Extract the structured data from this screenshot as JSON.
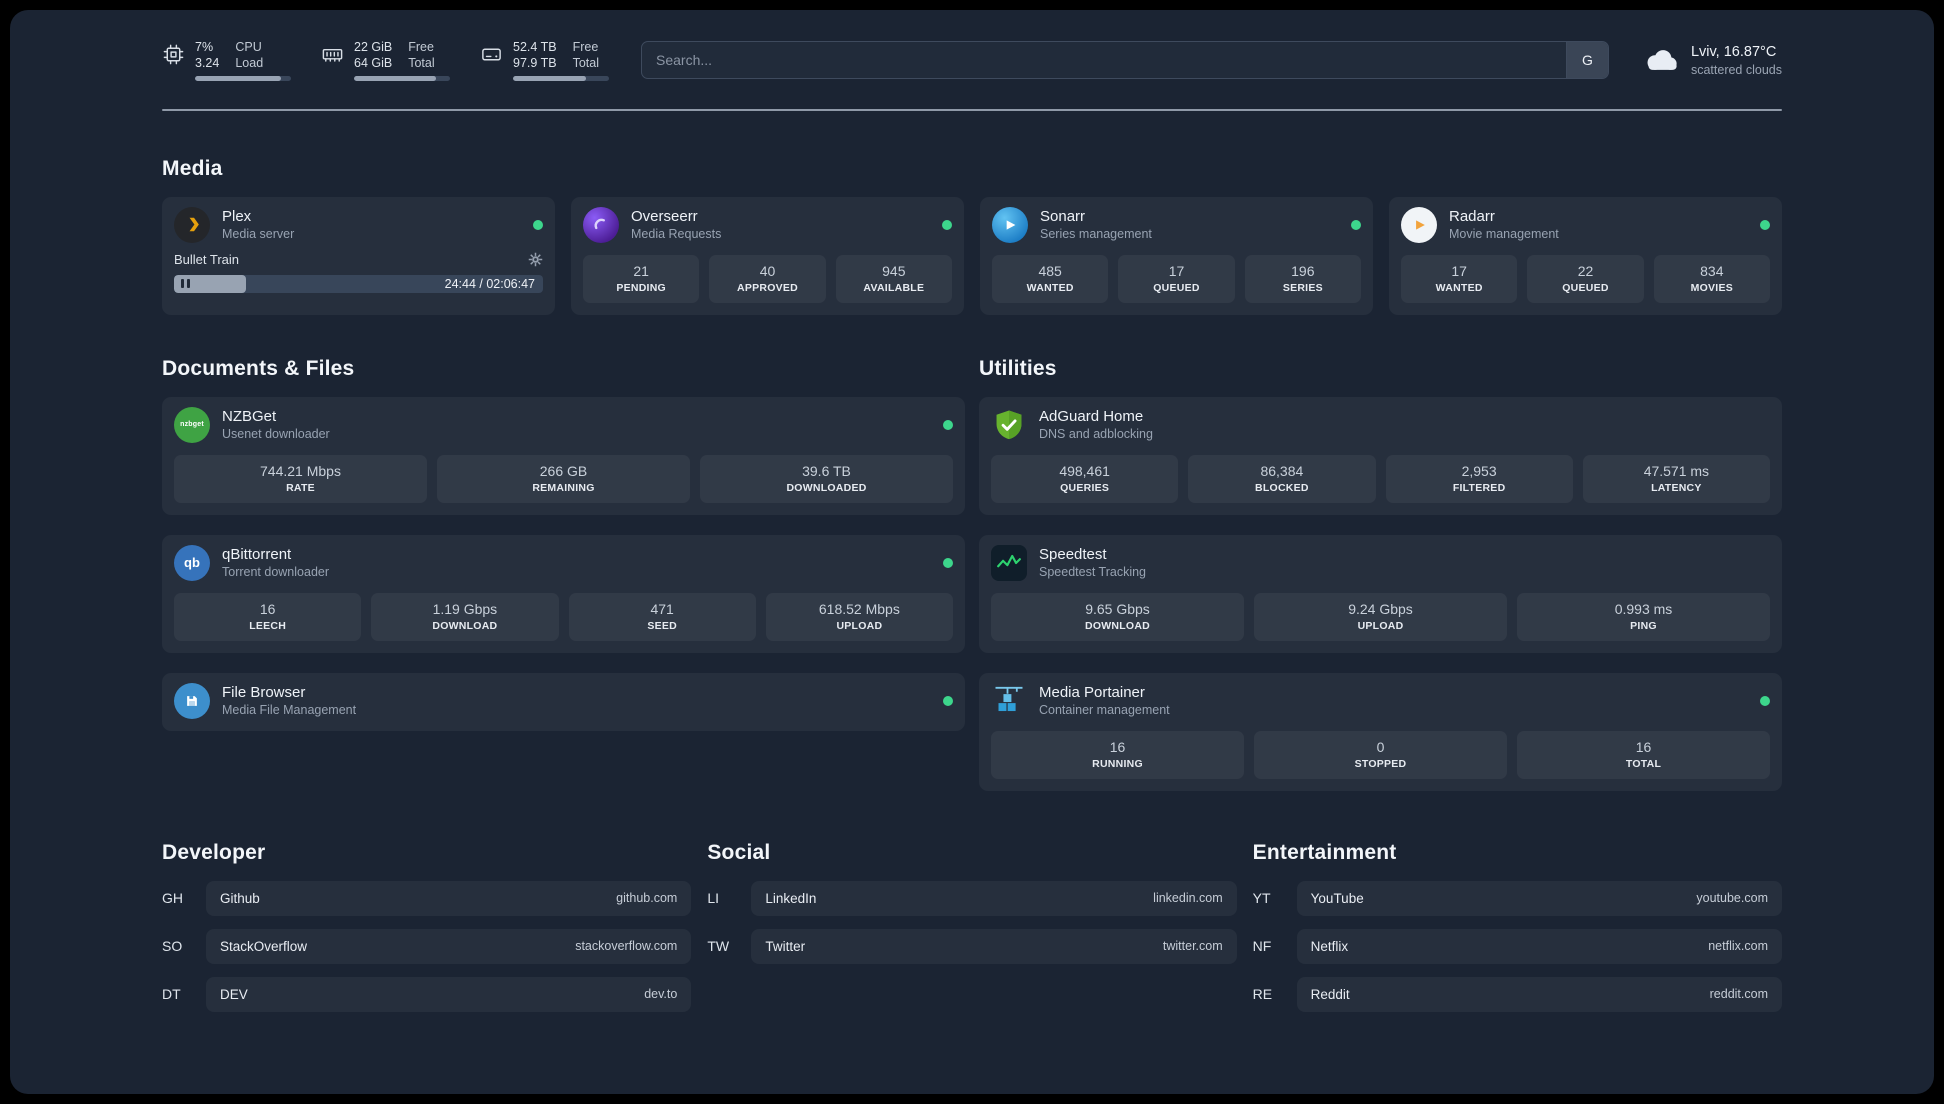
{
  "colors": {
    "background": "#000000",
    "panel": "#1b2433",
    "status_online": "#3dd68c",
    "plex_accent": "#e5a00d",
    "speedtest_accent": "#2dd36f"
  },
  "header": {
    "resources": [
      {
        "icon": "cpu-icon",
        "value_primary": "7%",
        "value_secondary": "3.24",
        "label_primary": "CPU",
        "label_secondary": "Load",
        "progress_width": "90%"
      },
      {
        "icon": "memory-icon",
        "value_primary": "22 GiB",
        "value_secondary": "64 GiB",
        "label_primary": "Free",
        "label_secondary": "Total",
        "progress_width": "85%"
      },
      {
        "icon": "disk-icon",
        "value_primary": "52.4 TB",
        "value_secondary": "97.9 TB",
        "label_primary": "Free",
        "label_secondary": "Total",
        "progress_width": "76%"
      }
    ],
    "search": {
      "placeholder": "Search...",
      "provider_button": "G"
    },
    "weather": {
      "icon": "cloud-icon",
      "location": "Lviv, 16.87°C",
      "condition": "scattered clouds"
    }
  },
  "media": {
    "title": "Media",
    "cards": [
      {
        "icon": "plex-icon",
        "name": "Plex",
        "description": "Media server",
        "status": "online",
        "now_playing": {
          "title": "Bullet Train",
          "time_display": "24:44 / 02:06:47",
          "progress_width": "19.5%"
        }
      },
      {
        "icon": "overseerr-icon",
        "name": "Overseerr",
        "description": "Media Requests",
        "status": "online",
        "stats": [
          {
            "value": "21",
            "label": "PENDING"
          },
          {
            "value": "40",
            "label": "APPROVED"
          },
          {
            "value": "945",
            "label": "AVAILABLE"
          }
        ]
      },
      {
        "icon": "sonarr-icon",
        "name": "Sonarr",
        "description": "Series management",
        "status": "online",
        "stats": [
          {
            "value": "485",
            "label": "WANTED"
          },
          {
            "value": "17",
            "label": "QUEUED"
          },
          {
            "value": "196",
            "label": "SERIES"
          }
        ]
      },
      {
        "icon": "radarr-icon",
        "name": "Radarr",
        "description": "Movie management",
        "status": "online",
        "stats": [
          {
            "value": "17",
            "label": "WANTED"
          },
          {
            "value": "22",
            "label": "QUEUED"
          },
          {
            "value": "834",
            "label": "MOVIES"
          }
        ]
      }
    ]
  },
  "documents": {
    "title": "Documents & Files",
    "cards": [
      {
        "icon": "nzbget-icon",
        "icon_text": "nzbget",
        "name": "NZBGet",
        "description": "Usenet downloader",
        "status": "online",
        "stats": [
          {
            "value": "744.21 Mbps",
            "label": "RATE"
          },
          {
            "value": "266 GB",
            "label": "REMAINING"
          },
          {
            "value": "39.6 TB",
            "label": "DOWNLOADED"
          }
        ]
      },
      {
        "icon": "qbittorrent-icon",
        "icon_text": "qb",
        "name": "qBittorrent",
        "description": "Torrent downloader",
        "status": "online",
        "stats": [
          {
            "value": "16",
            "label": "LEECH"
          },
          {
            "value": "1.19 Gbps",
            "label": "DOWNLOAD"
          },
          {
            "value": "471",
            "label": "SEED"
          },
          {
            "value": "618.52 Mbps",
            "label": "UPLOAD"
          }
        ]
      },
      {
        "icon": "filebrowser-icon",
        "name": "File Browser",
        "description": "Media File Management",
        "status": "online"
      }
    ]
  },
  "utilities": {
    "title": "Utilities",
    "cards": [
      {
        "icon": "adguard-icon",
        "name": "AdGuard Home",
        "description": "DNS and adblocking",
        "stats": [
          {
            "value": "498,461",
            "label": "QUERIES"
          },
          {
            "value": "86,384",
            "label": "BLOCKED"
          },
          {
            "value": "2,953",
            "label": "FILTERED"
          },
          {
            "value": "47.571 ms",
            "label": "LATENCY"
          }
        ]
      },
      {
        "icon": "speedtest-icon",
        "name": "Speedtest",
        "description": "Speedtest Tracking",
        "stats": [
          {
            "value": "9.65 Gbps",
            "label": "DOWNLOAD"
          },
          {
            "value": "9.24 Gbps",
            "label": "UPLOAD"
          },
          {
            "value": "0.993 ms",
            "label": "PING"
          }
        ]
      },
      {
        "icon": "portainer-icon",
        "name": "Media Portainer",
        "description": "Container management",
        "status": "online",
        "stats": [
          {
            "value": "16",
            "label": "RUNNING"
          },
          {
            "value": "0",
            "label": "STOPPED"
          },
          {
            "value": "16",
            "label": "TOTAL"
          }
        ]
      }
    ]
  },
  "bookmarks": {
    "groups": [
      {
        "title": "Developer",
        "items": [
          {
            "abbr": "GH",
            "name": "Github",
            "domain": "github.com"
          },
          {
            "abbr": "SO",
            "name": "StackOverflow",
            "domain": "stackoverflow.com"
          },
          {
            "abbr": "DT",
            "name": "DEV",
            "domain": "dev.to"
          }
        ]
      },
      {
        "title": "Social",
        "items": [
          {
            "abbr": "LI",
            "name": "LinkedIn",
            "domain": "linkedin.com"
          },
          {
            "abbr": "TW",
            "name": "Twitter",
            "domain": "twitter.com"
          }
        ]
      },
      {
        "title": "Entertainment",
        "items": [
          {
            "abbr": "YT",
            "name": "YouTube",
            "domain": "youtube.com"
          },
          {
            "abbr": "NF",
            "name": "Netflix",
            "domain": "netflix.com"
          },
          {
            "abbr": "RE",
            "name": "Reddit",
            "domain": "reddit.com"
          }
        ]
      }
    ]
  }
}
